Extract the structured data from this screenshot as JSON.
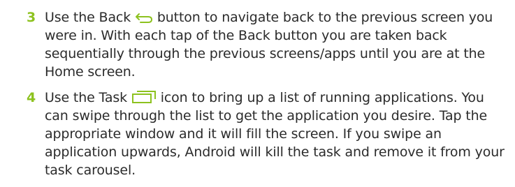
{
  "colors": {
    "accent": "#8dc21f",
    "text": "#2b2b2b"
  },
  "steps": [
    {
      "number": "3",
      "text_before_icon": "Use the Back ",
      "icon": "back-arrow-icon",
      "text_after_icon": " button to navigate back to the previous screen you were in. With each tap of the Back button you are taken back sequentially through the previous screens/apps until you are at the Home screen."
    },
    {
      "number": "4",
      "text_before_icon": "Use the Task ",
      "icon": "recent-tasks-icon",
      "text_after_icon": " icon to bring up a list of running applications. You can swipe through the list to get the application you desire. Tap the appropriate window and it will fill the screen. If you swipe an application upwards, Android will kill the task and remove it from your task carousel."
    }
  ]
}
